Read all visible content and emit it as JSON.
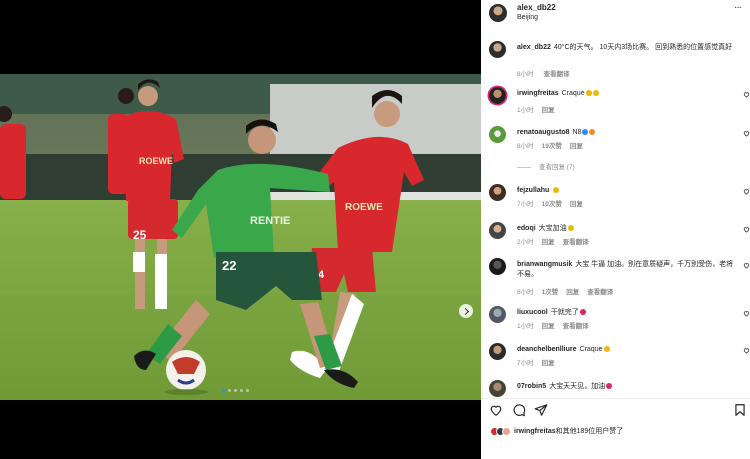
{
  "post": {
    "username": "alex_db22",
    "location": "Beijing",
    "more_glyph": "···",
    "watermark": "",
    "photo_dots": 5,
    "photo_dot_active": 0
  },
  "caption": {
    "username": "alex_db22",
    "text": "40°C的天气。 10天内3场比赛。 回到熟悉的位置感觉真好",
    "time": "8小时",
    "translate": "查看翻译"
  },
  "comments": [
    {
      "user": "irwingfreitas",
      "text": "Craque",
      "emoji": "clap-emoji-x2",
      "time": "1小时",
      "likes": "",
      "reply": "回复",
      "translate": ""
    },
    {
      "user": "renatoaugusto8",
      "text": "N8",
      "emoji": "verified-badge+fire-emoji",
      "time": "8小时",
      "likes": "19次赞",
      "reply": "回复",
      "translate": ""
    },
    {
      "user": "fejzullahu",
      "text": "",
      "emoji": "grin-emoji",
      "time": "7小时",
      "likes": "10次赞",
      "reply": "回复",
      "translate": ""
    },
    {
      "user": "edoqi",
      "text": "大宝加油",
      "emoji": "grin-emoji",
      "time": "2小时",
      "likes": "",
      "reply": "回复",
      "translate": "查看翻译"
    },
    {
      "user": "brianwangmusik",
      "text": "大宝 牛逼 加油。别在意质疑声，千万别受伤，老将不易。",
      "emoji": "",
      "time": "8小时",
      "likes": "1次赞",
      "reply": "回复",
      "translate": "查看翻译"
    },
    {
      "user": "liuxucool",
      "text": "干就完了",
      "emoji": "heart-emoji",
      "time": "1小时",
      "likes": "",
      "reply": "回复",
      "translate": "查看翻译"
    },
    {
      "user": "deanchelbenlliure",
      "text": "Craque",
      "emoji": "clap-emoji",
      "time": "7小时",
      "likes": "",
      "reply": "回复",
      "translate": ""
    },
    {
      "user": "07robin5",
      "text": "大宝天天见，加油",
      "emoji": "heart-emoji",
      "time": "",
      "likes": "",
      "reply": "",
      "translate": ""
    }
  ],
  "view_replies": "查看回复 (7)",
  "actions": {
    "like_icon": "heart-outline-icon",
    "comment_icon": "comment-bubble-icon",
    "share_icon": "paper-plane-icon",
    "save_icon": "bookmark-icon"
  },
  "likes_line": {
    "user": "irwingfreitas",
    "rest": "和其他189位用户赞了"
  },
  "colors": {
    "panel_bg": "#ffffff",
    "text": "#262626",
    "muted": "#8e8e8e",
    "pitch": "#7ba83d",
    "home_kit": "#3aa84a",
    "away_kit": "#d9272e",
    "dot_active": "#1e90ff"
  }
}
